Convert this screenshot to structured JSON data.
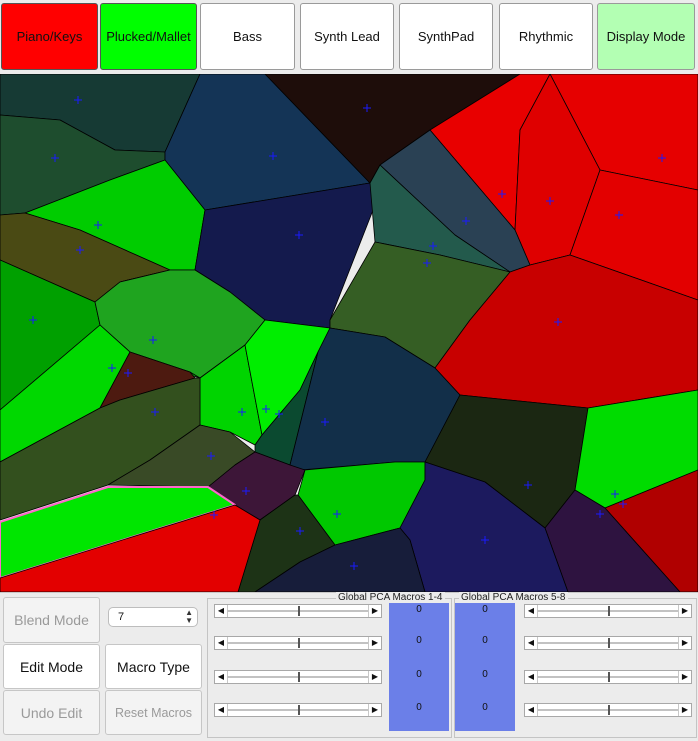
{
  "category_buttons": [
    {
      "label": "Piano/Keys",
      "state": "active",
      "color": "#ff0000"
    },
    {
      "label": "Plucked/Mallet",
      "state": "active",
      "color": "#00ff00"
    },
    {
      "label": "Bass",
      "state": "inactive",
      "color": "#ffffff"
    },
    {
      "label": "Synth Lead",
      "state": "inactive",
      "color": "#ffffff"
    },
    {
      "label": "SynthPad",
      "state": "inactive",
      "color": "#ffffff"
    },
    {
      "label": "Rhythmic",
      "state": "inactive",
      "color": "#ffffff"
    },
    {
      "label": "Display Mode",
      "state": "toggle",
      "color": "#b3ffb3"
    }
  ],
  "controls": {
    "blend_mode_label": "Blend Mode",
    "edit_mode_label": "Edit Mode",
    "undo_edit_label": "Undo Edit",
    "macro_type_label": "Macro Type",
    "reset_macros_label": "Reset Macros",
    "macro_spin_value": "7"
  },
  "macros_1_4": {
    "title": "Global PCA Macros 1-4",
    "values": [
      "0",
      "0",
      "0",
      "0"
    ],
    "slider_levels": [
      0.5,
      0.5,
      0.5,
      0.5
    ]
  },
  "macros_5_8": {
    "title": "Global PCA Macros 5-8",
    "values": [
      "0",
      "0",
      "0",
      "0"
    ],
    "slider_levels": [
      0.5,
      0.5,
      0.5,
      0.5
    ]
  },
  "colors": {
    "piano_keys": "#ff0000",
    "plucked_mallet": "#00ff00",
    "marker": "#0000ff",
    "value_column": "#6b7fe8"
  }
}
